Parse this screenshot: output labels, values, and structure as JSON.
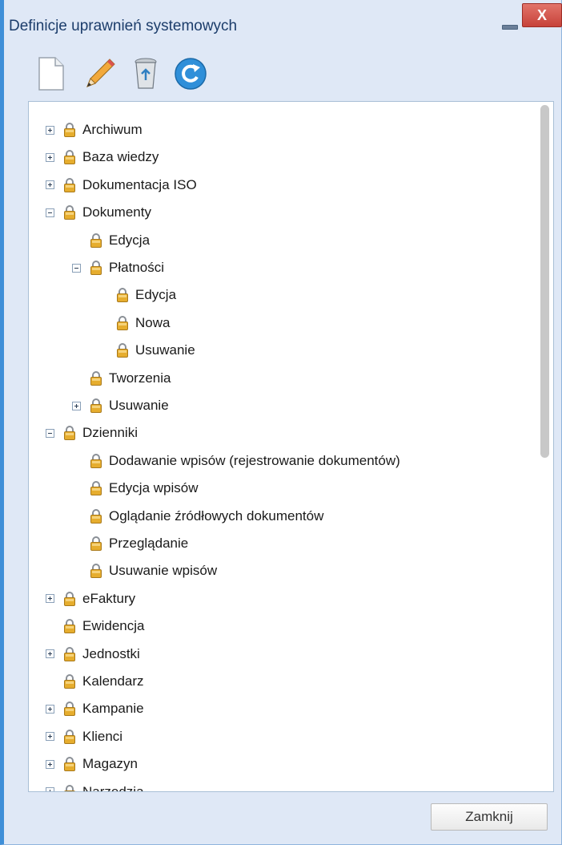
{
  "window": {
    "title": "Definicje uprawnień systemowych",
    "close_label": "X"
  },
  "toolbar": {
    "buttons": [
      {
        "icon": "new-document-icon"
      },
      {
        "icon": "edit-pencil-icon"
      },
      {
        "icon": "recycle-bin-icon"
      },
      {
        "icon": "refresh-icon"
      }
    ]
  },
  "tree": {
    "nodes": [
      {
        "label": "Archiwum",
        "level": 0,
        "toggle": "plus"
      },
      {
        "label": "Baza wiedzy",
        "level": 0,
        "toggle": "plus"
      },
      {
        "label": "Dokumentacja ISO",
        "level": 0,
        "toggle": "plus"
      },
      {
        "label": "Dokumenty",
        "level": 0,
        "toggle": "minus"
      },
      {
        "label": "Edycja",
        "level": 1,
        "toggle": "none"
      },
      {
        "label": "Płatności",
        "level": 1,
        "toggle": "minus"
      },
      {
        "label": "Edycja",
        "level": 2,
        "toggle": "none"
      },
      {
        "label": "Nowa",
        "level": 2,
        "toggle": "none"
      },
      {
        "label": "Usuwanie",
        "level": 2,
        "toggle": "none"
      },
      {
        "label": "Tworzenia",
        "level": 1,
        "toggle": "none"
      },
      {
        "label": "Usuwanie",
        "level": 1,
        "toggle": "plus"
      },
      {
        "label": "Dzienniki",
        "level": 0,
        "toggle": "minus"
      },
      {
        "label": "Dodawanie wpisów (rejestrowanie dokumentów)",
        "level": 1,
        "toggle": "none"
      },
      {
        "label": "Edycja wpisów",
        "level": 1,
        "toggle": "none"
      },
      {
        "label": "Oglądanie źródłowych dokumentów",
        "level": 1,
        "toggle": "none"
      },
      {
        "label": "Przeglądanie",
        "level": 1,
        "toggle": "none"
      },
      {
        "label": "Usuwanie wpisów",
        "level": 1,
        "toggle": "none"
      },
      {
        "label": "eFaktury",
        "level": 0,
        "toggle": "plus"
      },
      {
        "label": "Ewidencja",
        "level": 0,
        "toggle": "none"
      },
      {
        "label": "Jednostki",
        "level": 0,
        "toggle": "plus"
      },
      {
        "label": "Kalendarz",
        "level": 0,
        "toggle": "none"
      },
      {
        "label": "Kampanie",
        "level": 0,
        "toggle": "plus"
      },
      {
        "label": "Klienci",
        "level": 0,
        "toggle": "plus"
      },
      {
        "label": "Magazyn",
        "level": 0,
        "toggle": "plus"
      },
      {
        "label": "Narzędzia",
        "level": 0,
        "toggle": "plus"
      }
    ]
  },
  "footer": {
    "close_button": "Zamknij"
  },
  "colors": {
    "window_bg": "#dfe8f6",
    "accent": "#3f8fd8",
    "close_red": "#c7423a",
    "lock_gold": "#e0a72a"
  }
}
